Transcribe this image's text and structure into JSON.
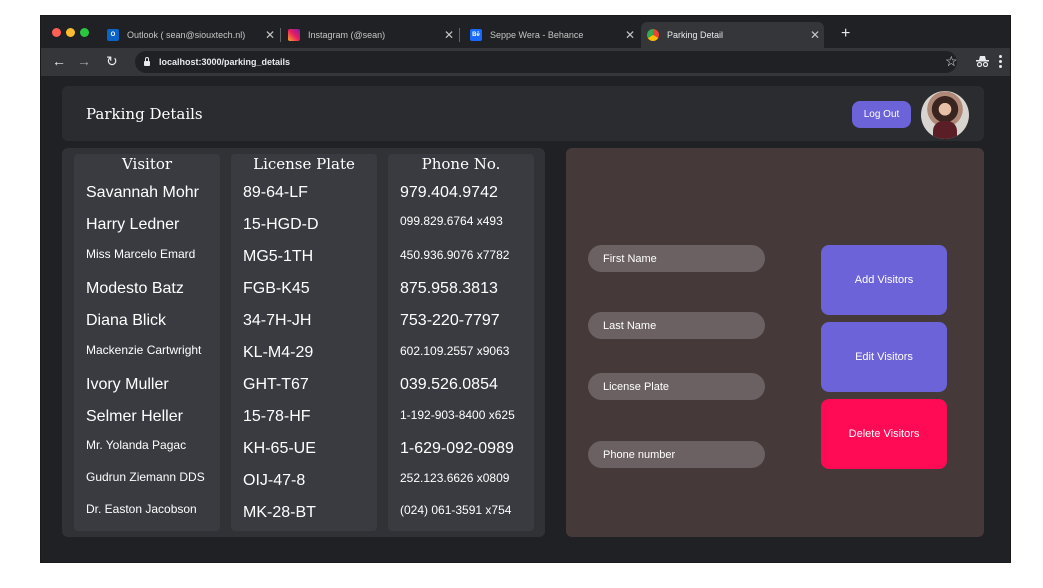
{
  "browser": {
    "tabs": [
      {
        "label": "Outlook ( sean@siouxtech.nl)",
        "icon": "outlook-icon"
      },
      {
        "label": "Instagram (@sean)",
        "icon": "instagram-icon"
      },
      {
        "label": "Seppe Wera - Behance",
        "icon": "behance-icon"
      },
      {
        "label": "Parking Detail",
        "icon": "chrome-icon",
        "active": true
      }
    ],
    "new_tab_symbol": "+",
    "close_symbol": "✕",
    "url": "localhost:3000/parking_details"
  },
  "header": {
    "title": "Parking Details",
    "logout_label": "Log Out"
  },
  "table": {
    "columns": [
      "Visitor",
      "License Plate",
      "Phone No."
    ],
    "rows": [
      {
        "visitor": "Savannah Mohr",
        "plate": "89-64-LF",
        "phone": "979.404.9742"
      },
      {
        "visitor": "Harry Ledner",
        "plate": "15-HGD-D",
        "phone": "099.829.6764 x493"
      },
      {
        "visitor": "Miss Marcelo Emard",
        "plate": "MG5-1TH",
        "phone": "450.936.9076 x7782"
      },
      {
        "visitor": "Modesto Batz",
        "plate": "FGB-K45",
        "phone": "875.958.3813"
      },
      {
        "visitor": "Diana Blick",
        "plate": "34-7H-JH",
        "phone": "753-220-7797"
      },
      {
        "visitor": "Mackenzie Cartwright",
        "plate": "KL-M4-29",
        "phone": "602.109.2557 x9063"
      },
      {
        "visitor": "Ivory Muller",
        "plate": "GHT-T67",
        "phone": "039.526.0854"
      },
      {
        "visitor": "Selmer Heller",
        "plate": "15-78-HF",
        "phone": "1-192-903-8400 x625"
      },
      {
        "visitor": "Mr. Yolanda Pagac",
        "plate": "KH-65-UE",
        "phone": "1-629-092-0989"
      },
      {
        "visitor": "Gudrun Ziemann DDS",
        "plate": "OIJ-47-8",
        "phone": "252.123.6626 x0809"
      },
      {
        "visitor": "Dr. Easton Jacobson",
        "plate": "MK-28-BT",
        "phone": "(024) 061-3591 x754"
      }
    ]
  },
  "form": {
    "first_name_placeholder": "First Name",
    "last_name_placeholder": "Last Name",
    "license_plate_placeholder": "License Plate",
    "phone_placeholder": "Phone number",
    "add_label": "Add Visitors",
    "edit_label": "Edit Visitors",
    "delete_label": "Delete Visitors"
  },
  "colors": {
    "accent": "#6c63d8",
    "danger": "#ff0a55",
    "form_panel": "#45393a"
  }
}
